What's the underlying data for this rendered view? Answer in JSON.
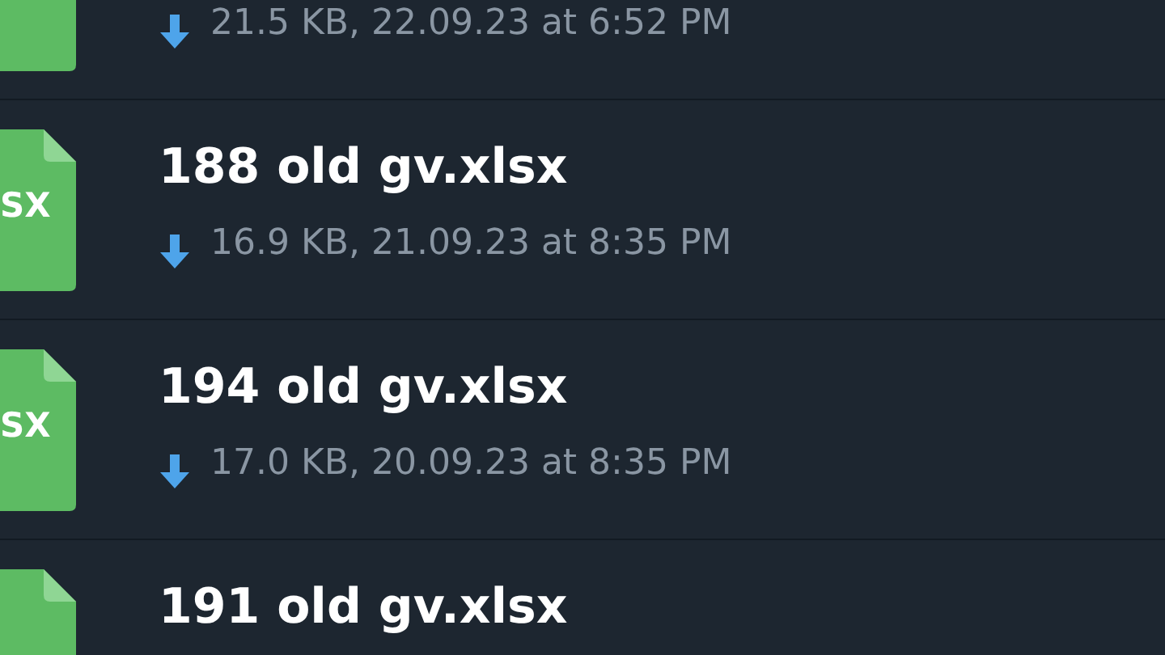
{
  "files": [
    {
      "meta": "21.5 KB, 22.09.23 at 6:52 PM"
    },
    {
      "name": "188 old gv.xlsx",
      "icon_label": "SX",
      "meta": "16.9 KB, 21.09.23 at 8:35 PM"
    },
    {
      "name": "194 old gv.xlsx",
      "icon_label": "SX",
      "meta": "17.0 KB, 20.09.23 at 8:35 PM"
    },
    {
      "name": "191 old gv.xlsx"
    }
  ]
}
